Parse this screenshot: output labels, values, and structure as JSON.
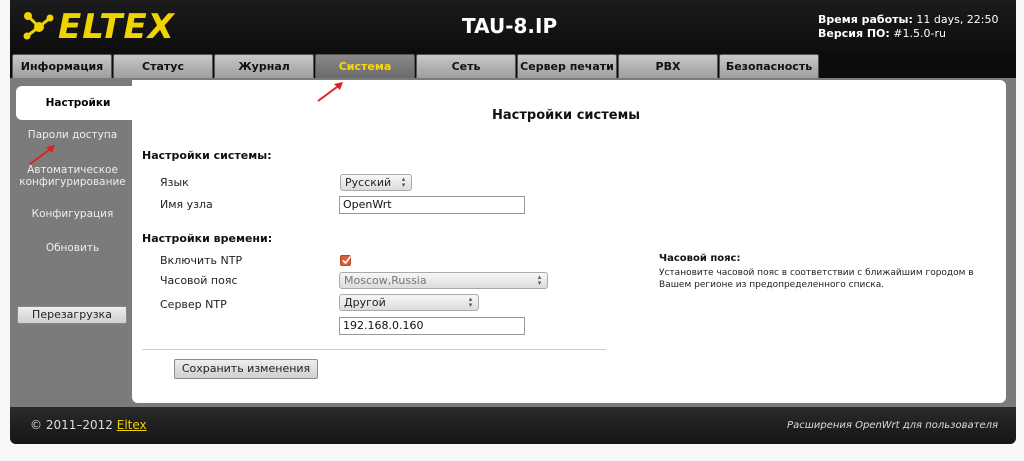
{
  "brand": {
    "logo_text": "ELTEX"
  },
  "header": {
    "device_name": "TAU-8.IP",
    "uptime_label": "Время работы:",
    "uptime_value": "11 days, 22:50",
    "firmware_label": "Версия ПО:",
    "firmware_value": "#1.5.0-ru"
  },
  "tabs": [
    {
      "label": "Информация"
    },
    {
      "label": "Статус"
    },
    {
      "label": "Журнал"
    },
    {
      "label": "Система",
      "active": true
    },
    {
      "label": "Сеть"
    },
    {
      "label": "Сервер печати"
    },
    {
      "label": "PBX"
    },
    {
      "label": "Безопасность"
    }
  ],
  "sidebar": {
    "items": [
      {
        "label": "Настройки",
        "active": true
      },
      {
        "label": "Пароли доступа"
      },
      {
        "label": "Автоматическое конфигурирование"
      },
      {
        "label": "Конфигурация"
      },
      {
        "label": "Обновить"
      }
    ],
    "reboot_label": "Перезагрузка"
  },
  "main": {
    "title": "Настройки системы",
    "system_section": {
      "title": "Настройки системы:",
      "language_label": "Язык",
      "language_value": "Русский",
      "hostname_label": "Имя узла",
      "hostname_value": "OpenWrt"
    },
    "time_section": {
      "title": "Настройки времени:",
      "ntp_enable_label": "Включить NTP",
      "ntp_enabled": true,
      "timezone_label": "Часовой пояс",
      "timezone_value": "Moscow,Russia",
      "ntp_server_label": "Сервер NTP",
      "ntp_server_select": "Другой",
      "ntp_server_value": "192.168.0.160"
    },
    "help": {
      "title": "Часовой пояс:",
      "text": "Установите часовой пояс в соответствии с ближайшим городом в Вашем регионе из предопределенного списка."
    },
    "save_label": "Сохранить изменения"
  },
  "footer": {
    "copyright": "© 2011–2012",
    "copyright_link": "Eltex",
    "right_text": "Расширения OpenWrt для пользователя"
  },
  "colors": {
    "brand_yellow": "#f0d400",
    "active_tab_text": "#ffd800",
    "checkbox": "#d9603a",
    "annotation_arrow": "#e02020"
  }
}
